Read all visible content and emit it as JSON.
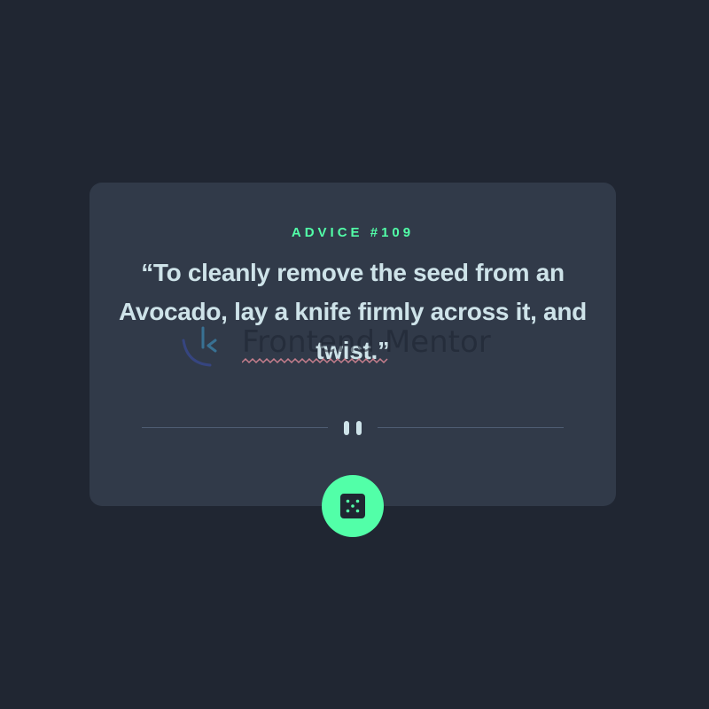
{
  "advice": {
    "id_label": "ADVICE #109",
    "text": "“To cleanly remove the seed from an Avocado, lay a knife firmly across it, and twist.”"
  },
  "watermark": {
    "text": "Frontend Mentor",
    "icon": "frontend-mentor-logo"
  },
  "divider": {
    "icon": "pause-icon"
  },
  "dice_button": {
    "icon": "dice-icon"
  },
  "colors": {
    "background": "#202632",
    "card": "#313a49",
    "accent": "#52ffa8",
    "text": "#cee3e9",
    "divider": "#4f5d74"
  }
}
